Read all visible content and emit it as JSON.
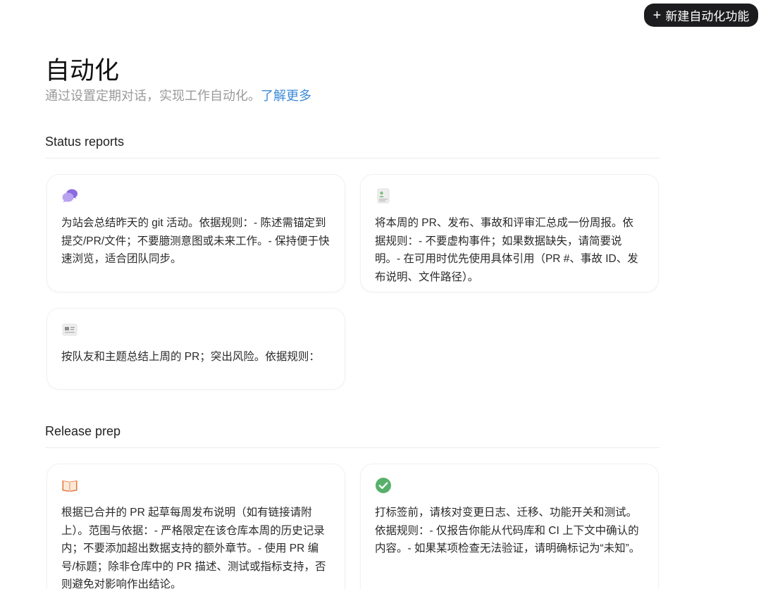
{
  "header": {
    "new_button_label": "新建自动化功能",
    "title": "自动化",
    "subtitle": "通过设置定期对话，实现工作自动化。",
    "learn_more": "了解更多"
  },
  "sections": [
    {
      "title": "Status reports",
      "cards": [
        {
          "icon": "chat-bubbles-icon",
          "text": "为站会总结昨天的 git 活动。依据规则：- 陈述需锚定到提交/PR/文件；不要臆测意图或未来工作。- 保持便于快速浏览，适合团队同步。"
        },
        {
          "icon": "report-document-icon",
          "text": "将本周的 PR、发布、事故和评审汇总成一份周报。依据规则：- 不要虚构事件；如果数据缺失，请简要说明。- 在可用时优先使用具体引用（PR #、事故 ID、发布说明、文件路径）。"
        },
        {
          "icon": "newspaper-icon",
          "text": "按队友和主题总结上周的 PR；突出风险。依据规则："
        }
      ]
    },
    {
      "title": "Release prep",
      "cards": [
        {
          "icon": "open-book-icon",
          "text": "根据已合并的 PR 起草每周发布说明（如有链接请附上）。范围与依据：- 严格限定在该仓库本周的历史记录内；不要添加超出数据支持的额外章节。- 使用 PR 编号/标题；除非仓库中的 PR 描述、测试或指标支持，否则避免对影响作出结论。"
        },
        {
          "icon": "check-circle-icon",
          "text": "打标签前，请核对变更日志、迁移、功能开关和测试。依据规则：- 仅报告你能从代码库和 CI 上下文中确认的内容。- 如果某项检查无法验证，请明确标记为“未知”。"
        }
      ]
    }
  ]
}
